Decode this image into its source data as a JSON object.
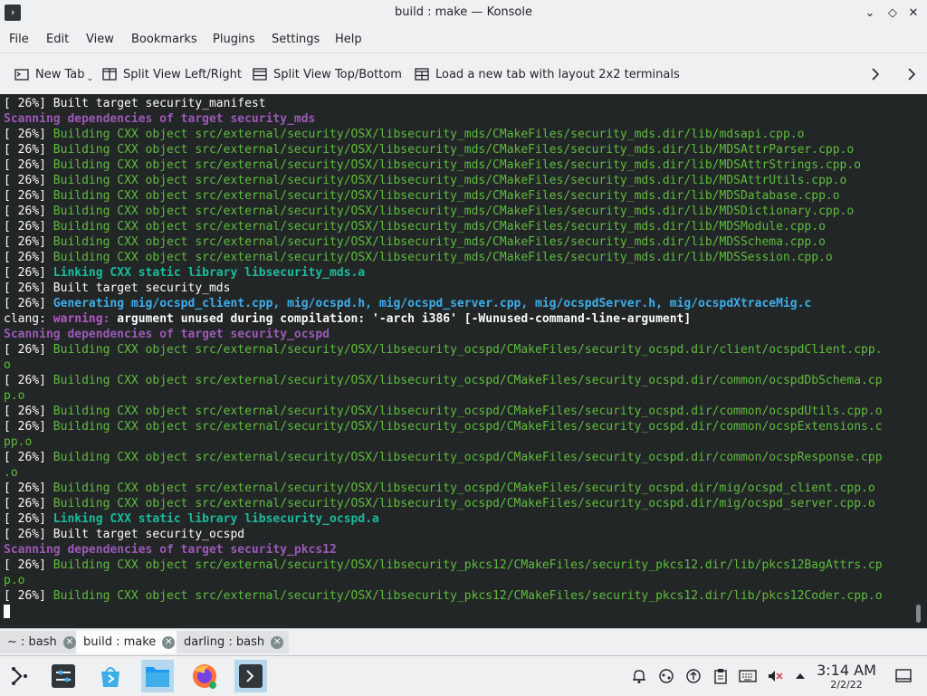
{
  "window": {
    "title": "build : make — Konsole",
    "app_icon_glyph": "›",
    "minimize_glyph": "⌄",
    "maximize_glyph": "◇",
    "close_glyph": "✕"
  },
  "menu": [
    "File",
    "Edit",
    "View",
    "Bookmarks",
    "Plugins",
    "Settings",
    "Help"
  ],
  "toolbar": {
    "new_tab": "New Tab",
    "split_lr": "Split View Left/Right",
    "split_tb": "Split View Top/Bottom",
    "layout_2x2": "Load a new tab with layout 2x2 terminals"
  },
  "terminal": {
    "lines": [
      [
        {
          "t": "[ 26%] Built target security_manifest",
          "c": ""
        }
      ],
      [
        {
          "t": "Scanning dependencies of target security_mds",
          "c": "c-purple"
        }
      ],
      [
        {
          "t": "[ 26%] ",
          "c": ""
        },
        {
          "t": "Building CXX object src/external/security/OSX/libsecurity_mds/CMakeFiles/security_mds.dir/lib/mdsapi.cpp.o",
          "c": "c-green"
        }
      ],
      [
        {
          "t": "[ 26%] ",
          "c": ""
        },
        {
          "t": "Building CXX object src/external/security/OSX/libsecurity_mds/CMakeFiles/security_mds.dir/lib/MDSAttrParser.cpp.o",
          "c": "c-green"
        }
      ],
      [
        {
          "t": "[ 26%] ",
          "c": ""
        },
        {
          "t": "Building CXX object src/external/security/OSX/libsecurity_mds/CMakeFiles/security_mds.dir/lib/MDSAttrStrings.cpp.o",
          "c": "c-green"
        }
      ],
      [
        {
          "t": "[ 26%] ",
          "c": ""
        },
        {
          "t": "Building CXX object src/external/security/OSX/libsecurity_mds/CMakeFiles/security_mds.dir/lib/MDSAttrUtils.cpp.o",
          "c": "c-green"
        }
      ],
      [
        {
          "t": "[ 26%] ",
          "c": ""
        },
        {
          "t": "Building CXX object src/external/security/OSX/libsecurity_mds/CMakeFiles/security_mds.dir/lib/MDSDatabase.cpp.o",
          "c": "c-green"
        }
      ],
      [
        {
          "t": "[ 26%] ",
          "c": ""
        },
        {
          "t": "Building CXX object src/external/security/OSX/libsecurity_mds/CMakeFiles/security_mds.dir/lib/MDSDictionary.cpp.o",
          "c": "c-green"
        }
      ],
      [
        {
          "t": "[ 26%] ",
          "c": ""
        },
        {
          "t": "Building CXX object src/external/security/OSX/libsecurity_mds/CMakeFiles/security_mds.dir/lib/MDSModule.cpp.o",
          "c": "c-green"
        }
      ],
      [
        {
          "t": "[ 26%] ",
          "c": ""
        },
        {
          "t": "Building CXX object src/external/security/OSX/libsecurity_mds/CMakeFiles/security_mds.dir/lib/MDSSchema.cpp.o",
          "c": "c-green"
        }
      ],
      [
        {
          "t": "[ 26%] ",
          "c": ""
        },
        {
          "t": "Building CXX object src/external/security/OSX/libsecurity_mds/CMakeFiles/security_mds.dir/lib/MDSSession.cpp.o",
          "c": "c-green"
        }
      ],
      [
        {
          "t": "[ 26%] ",
          "c": ""
        },
        {
          "t": "Linking CXX static library libsecurity_mds.a",
          "c": "c-teal"
        }
      ],
      [
        {
          "t": "[ 26%] Built target security_mds",
          "c": ""
        }
      ],
      [
        {
          "t": "[ 26%] ",
          "c": ""
        },
        {
          "t": "Generating mig/ocspd_client.cpp, mig/ocspd.h, mig/ocspd_server.cpp, mig/ocspdServer.h, mig/ocspdXtraceMig.c",
          "c": "c-blue"
        }
      ],
      [
        {
          "t": "clang: ",
          "c": ""
        },
        {
          "t": "warning: ",
          "c": "c-warn"
        },
        {
          "t": "argument unused during compilation: '-arch i386' [-Wunused-command-line-argument]",
          "c": "c-bold"
        }
      ],
      [
        {
          "t": "Scanning dependencies of target security_ocspd",
          "c": "c-purple"
        }
      ],
      [
        {
          "t": "[ 26%] ",
          "c": ""
        },
        {
          "t": "Building CXX object src/external/security/OSX/libsecurity_ocspd/CMakeFiles/security_ocspd.dir/client/ocspdClient.cpp.",
          "c": "c-green"
        }
      ],
      [
        {
          "t": "o",
          "c": "c-green"
        }
      ],
      [
        {
          "t": "[ 26%] ",
          "c": ""
        },
        {
          "t": "Building CXX object src/external/security/OSX/libsecurity_ocspd/CMakeFiles/security_ocspd.dir/common/ocspdDbSchema.cp",
          "c": "c-green"
        }
      ],
      [
        {
          "t": "p.o",
          "c": "c-green"
        }
      ],
      [
        {
          "t": "[ 26%] ",
          "c": ""
        },
        {
          "t": "Building CXX object src/external/security/OSX/libsecurity_ocspd/CMakeFiles/security_ocspd.dir/common/ocspdUtils.cpp.o",
          "c": "c-green"
        }
      ],
      [
        {
          "t": "[ 26%] ",
          "c": ""
        },
        {
          "t": "Building CXX object src/external/security/OSX/libsecurity_ocspd/CMakeFiles/security_ocspd.dir/common/ocspExtensions.c",
          "c": "c-green"
        }
      ],
      [
        {
          "t": "pp.o",
          "c": "c-green"
        }
      ],
      [
        {
          "t": "[ 26%] ",
          "c": ""
        },
        {
          "t": "Building CXX object src/external/security/OSX/libsecurity_ocspd/CMakeFiles/security_ocspd.dir/common/ocspResponse.cpp",
          "c": "c-green"
        }
      ],
      [
        {
          "t": ".o",
          "c": "c-green"
        }
      ],
      [
        {
          "t": "[ 26%] ",
          "c": ""
        },
        {
          "t": "Building CXX object src/external/security/OSX/libsecurity_ocspd/CMakeFiles/security_ocspd.dir/mig/ocspd_client.cpp.o",
          "c": "c-green"
        }
      ],
      [
        {
          "t": "[ 26%] ",
          "c": ""
        },
        {
          "t": "Building CXX object src/external/security/OSX/libsecurity_ocspd/CMakeFiles/security_ocspd.dir/mig/ocspd_server.cpp.o",
          "c": "c-green"
        }
      ],
      [
        {
          "t": "[ 26%] ",
          "c": ""
        },
        {
          "t": "Linking CXX static library libsecurity_ocspd.a",
          "c": "c-teal"
        }
      ],
      [
        {
          "t": "[ 26%] Built target security_ocspd",
          "c": ""
        }
      ],
      [
        {
          "t": "Scanning dependencies of target security_pkcs12",
          "c": "c-purple"
        }
      ],
      [
        {
          "t": "[ 26%] ",
          "c": ""
        },
        {
          "t": "Building CXX object src/external/security/OSX/libsecurity_pkcs12/CMakeFiles/security_pkcs12.dir/lib/pkcs12BagAttrs.cp",
          "c": "c-green"
        }
      ],
      [
        {
          "t": "p.o",
          "c": "c-green"
        }
      ],
      [
        {
          "t": "[ 26%] ",
          "c": ""
        },
        {
          "t": "Building CXX object src/external/security/OSX/libsecurity_pkcs12/CMakeFiles/security_pkcs12.dir/lib/pkcs12Coder.cpp.o",
          "c": "c-green"
        }
      ]
    ]
  },
  "tabs": [
    {
      "label": "~ : bash",
      "active": false
    },
    {
      "label": "build : make",
      "active": true
    },
    {
      "label": "darling : bash",
      "active": false
    }
  ],
  "tab_close_glyph": "✕",
  "clock": {
    "time": "3:14 AM",
    "date": "2/2/22"
  }
}
